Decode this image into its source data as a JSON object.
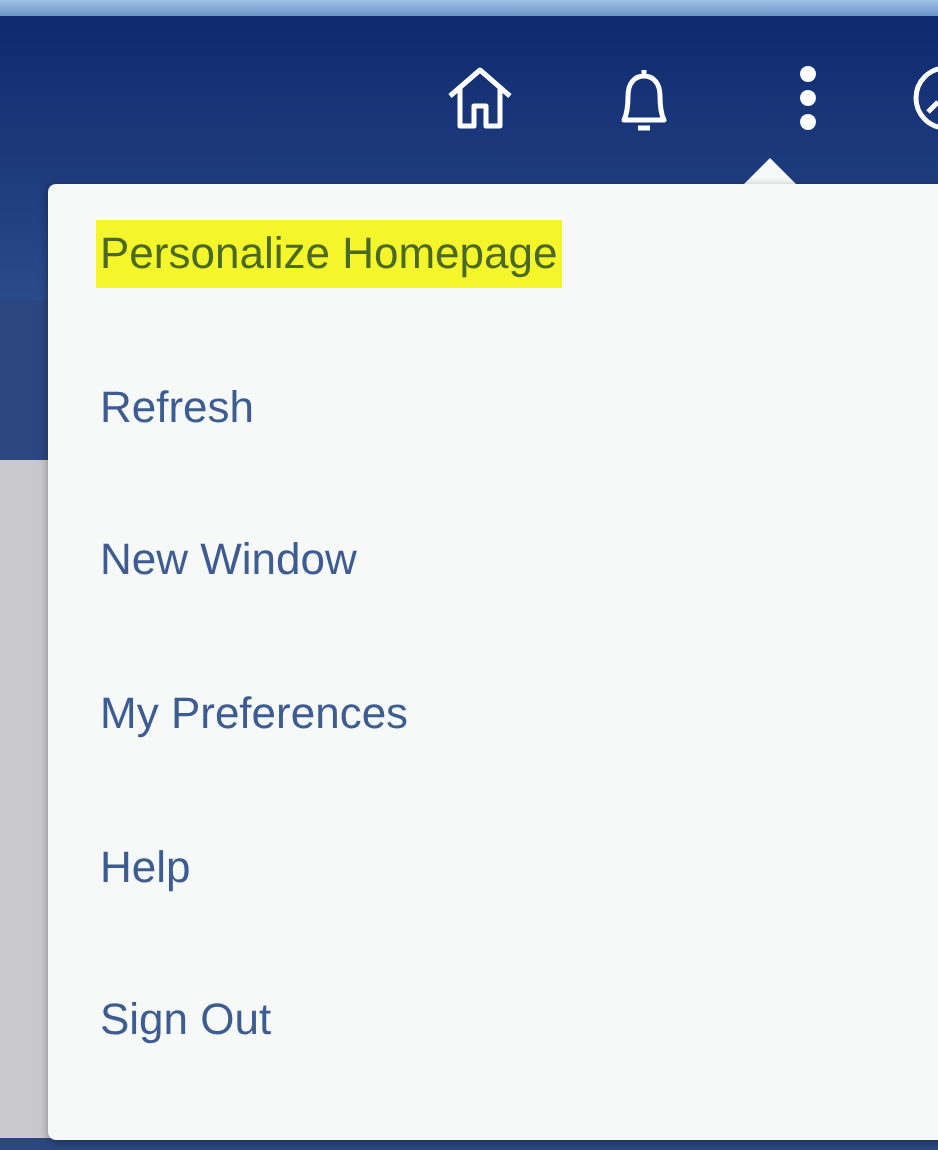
{
  "menu": {
    "items": [
      {
        "label": "Personalize Homepage",
        "highlighted": true
      },
      {
        "label": "Refresh",
        "highlighted": false
      },
      {
        "label": "New Window",
        "highlighted": false
      },
      {
        "label": "My Preferences",
        "highlighted": false
      },
      {
        "label": "Help",
        "highlighted": false
      },
      {
        "label": "Sign Out",
        "highlighted": false
      }
    ]
  }
}
